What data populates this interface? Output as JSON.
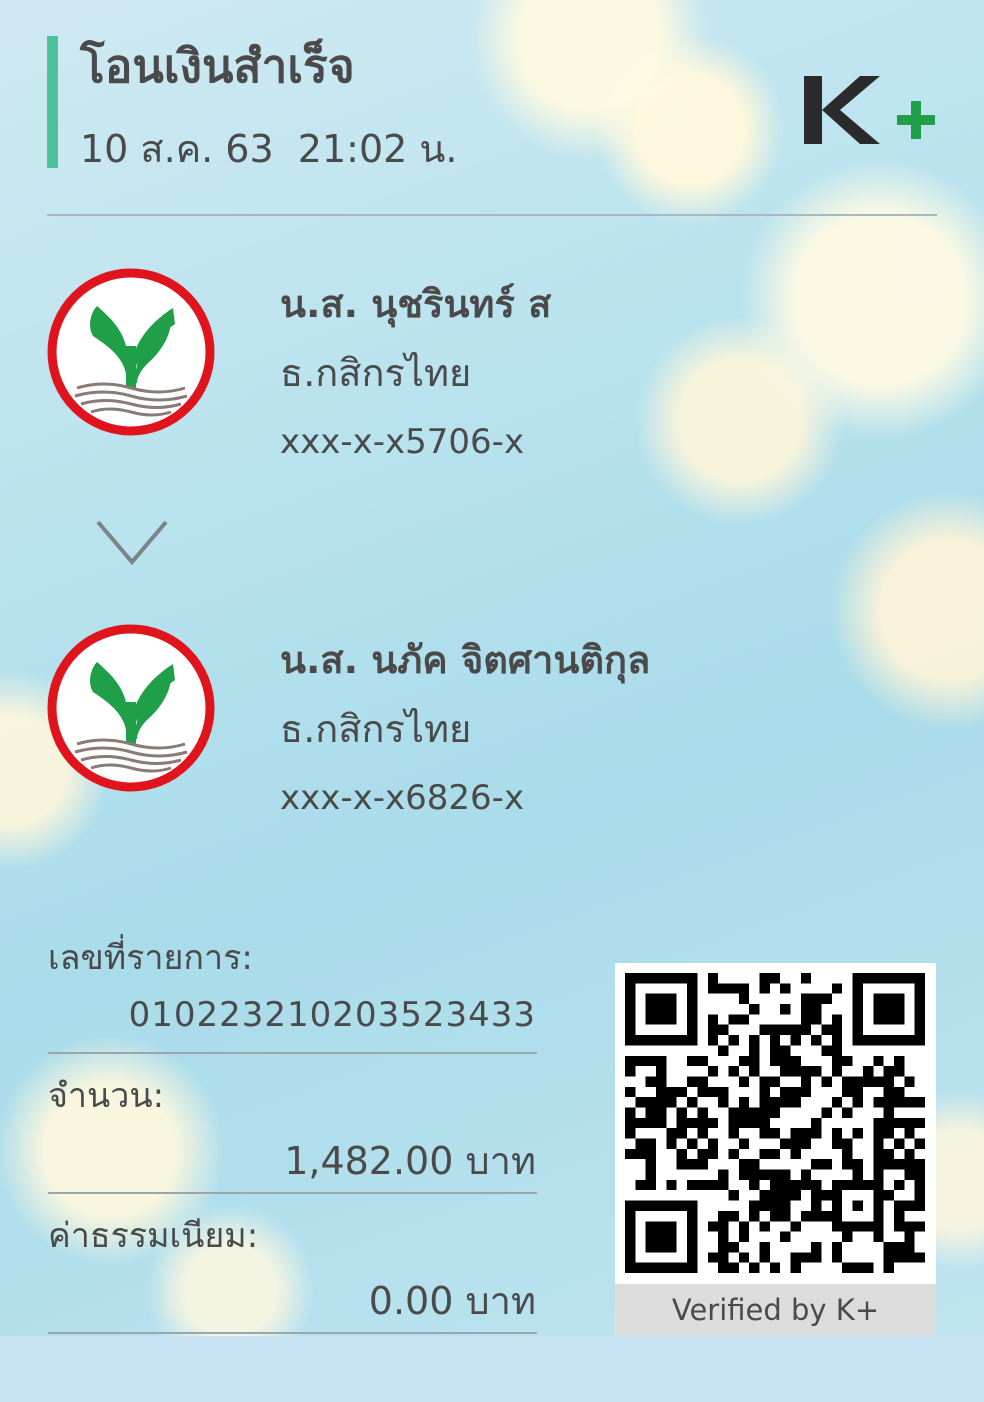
{
  "header": {
    "title": "โอนเงินสำเร็จ",
    "datetime": "10 ส.ค. 63  21:02 น.",
    "logo_text": "K+",
    "accent_color": "#4cc39a"
  },
  "sender": {
    "name": "น.ส. นุชรินทร์ ส",
    "bank": "ธ.กสิกรไทย",
    "account": "xxx-x-x5706-x",
    "bank_logo_icon": "kasikorn-bank-logo"
  },
  "receiver": {
    "name": "น.ส. นภัค จิตศานติกุล",
    "bank": "ธ.กสิกรไทย",
    "account": "xxx-x-x6826-x",
    "bank_logo_icon": "kasikorn-bank-logo"
  },
  "details": {
    "ref_label": "เลขที่รายการ:",
    "ref_value": "010223210203523433",
    "amount_label": "จำนวน:",
    "amount_value": "1,482.00 บาท",
    "fee_label": "ค่าธรรมเนียม:",
    "fee_value": "0.00 บาท"
  },
  "qr": {
    "caption": "Verified by K+"
  },
  "colors": {
    "brand_green": "#1f9f48",
    "bank_red": "#e0141c",
    "text": "#4a4a4a"
  }
}
